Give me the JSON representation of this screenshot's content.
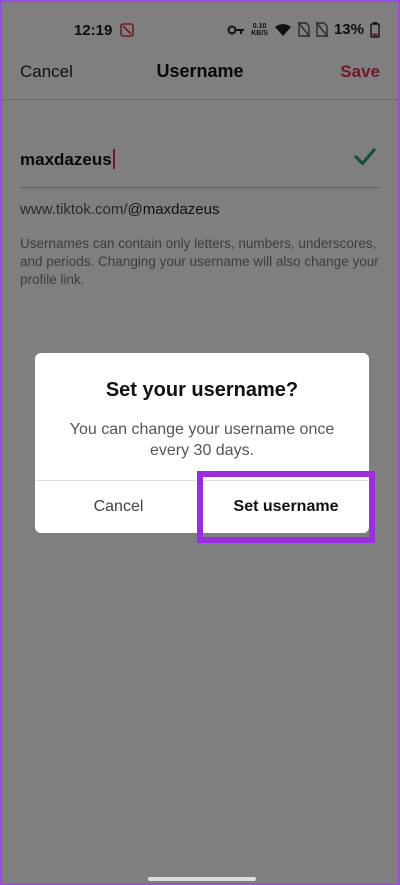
{
  "status_bar": {
    "time": "12:19",
    "net_speed_value": "0.10",
    "net_speed_unit": "KB/S",
    "battery_percent": "13%"
  },
  "nav": {
    "cancel_label": "Cancel",
    "title": "Username",
    "save_label": "Save"
  },
  "form": {
    "username_value": "maxdazeus",
    "profile_link_prefix": "www.tiktok.com/",
    "profile_link_handle": "@maxdazeus",
    "helper_text": "Usernames can contain only letters, numbers, underscores, and periods. Changing your username will also change your profile link."
  },
  "dialog": {
    "title": "Set your username?",
    "body": "You can change your username once every 30 days.",
    "cancel_label": "Cancel",
    "confirm_label": "Set username"
  },
  "colors": {
    "accent": "#e5334f",
    "check": "#2e9e6e",
    "highlight": "#9b2de0"
  },
  "icons": [
    "recording-icon",
    "key-icon",
    "wifi-icon",
    "no-sim-icon",
    "battery-icon",
    "checkmark-icon"
  ]
}
